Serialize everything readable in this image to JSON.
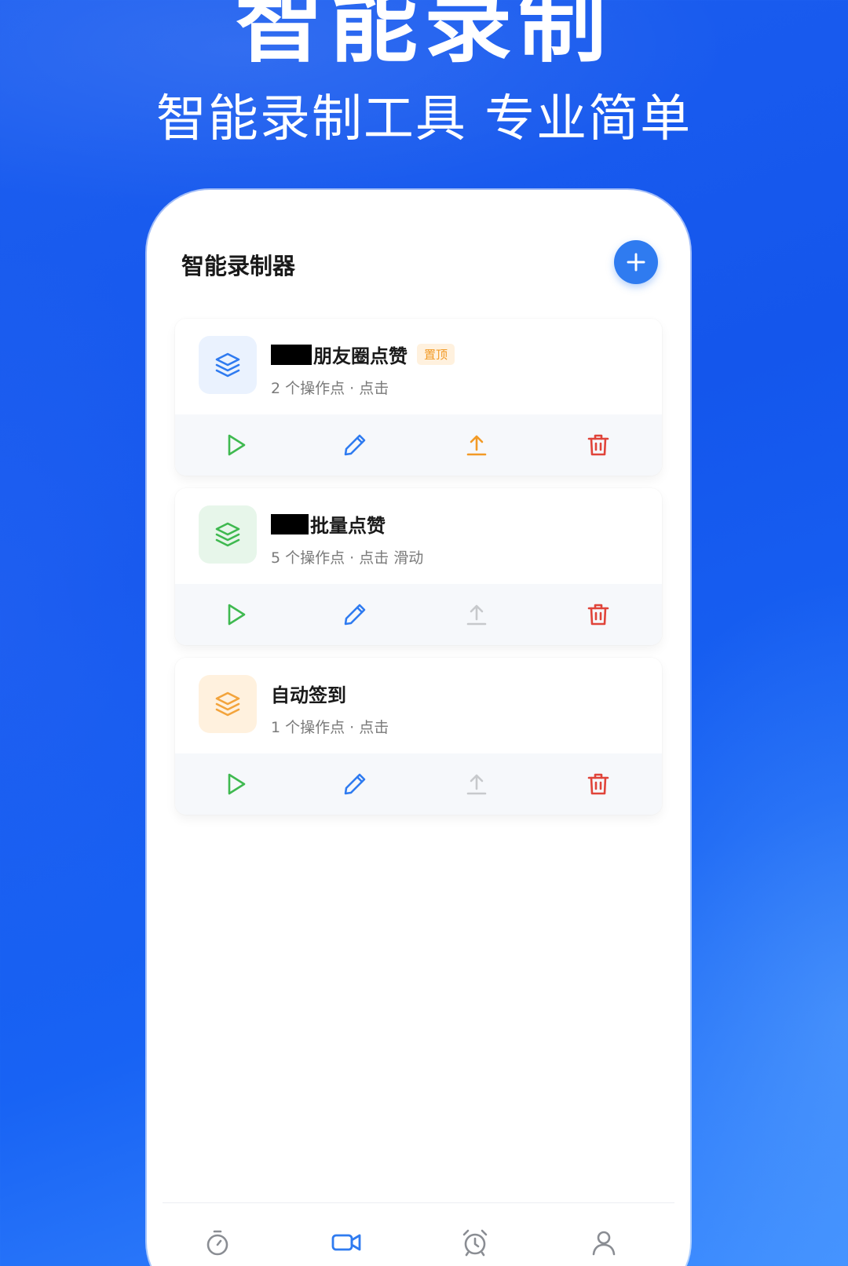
{
  "hero": {
    "title": "智能录制",
    "subtitle": "智能录制工具 专业简单"
  },
  "app": {
    "title": "智能录制器",
    "add_icon": "plus-icon"
  },
  "recordings": [
    {
      "name": "朋友圈点赞",
      "redacted_prefix": true,
      "pinned_label": "置顶",
      "meta": "2 个操作点 · 点击",
      "icon_color": "#2f7bf0",
      "icon_bg": "#eaf2fe",
      "upload_enabled": true
    },
    {
      "name": "批量点赞",
      "redacted_prefix": true,
      "meta": "5 个操作点 · 点击 滑动",
      "icon_color": "#3fb950",
      "icon_bg": "#e7f6ea",
      "upload_enabled": false
    },
    {
      "name": "自动签到",
      "redacted_prefix": false,
      "meta": "1 个操作点 · 点击",
      "icon_color": "#f3a43c",
      "icon_bg": "#fff1de",
      "upload_enabled": false
    }
  ],
  "actions": {
    "play_color": "#3fb950",
    "edit_color": "#2f7bf0",
    "upload_color_active": "#f29a26",
    "upload_color_disabled": "#c7c9cc",
    "delete_color": "#e0443a"
  },
  "tabbar": {
    "tabs": [
      {
        "icon": "stopwatch-icon",
        "active": false
      },
      {
        "icon": "video-camera-icon",
        "active": true
      },
      {
        "icon": "alarm-clock-icon",
        "active": false
      },
      {
        "icon": "user-icon",
        "active": false
      }
    ],
    "active_color": "#2f7bf0",
    "inactive_color": "#8a8d93"
  }
}
